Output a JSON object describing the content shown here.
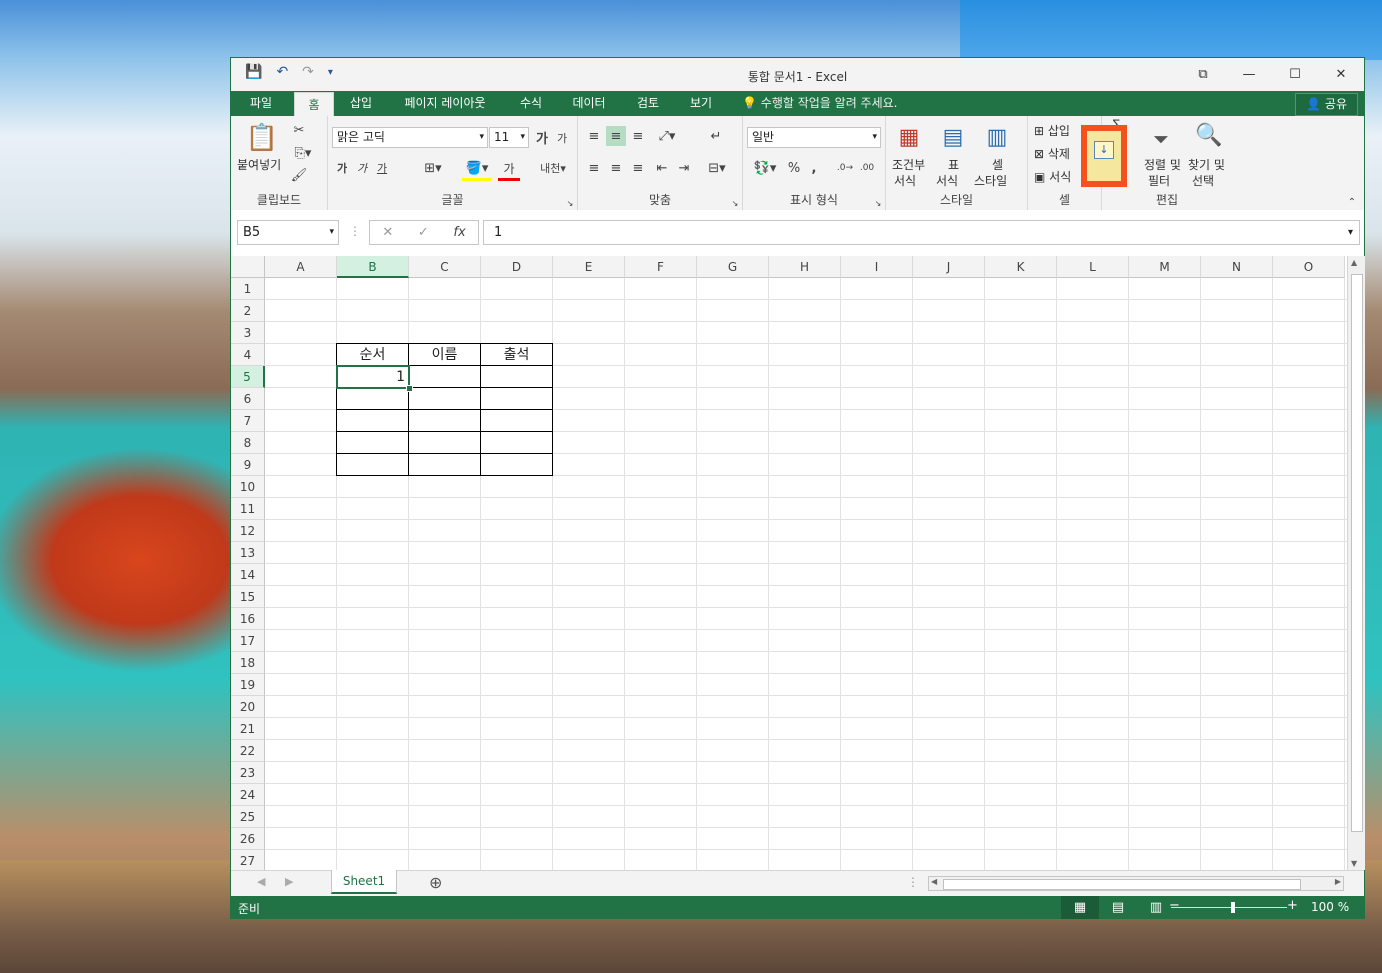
{
  "window": {
    "title": "통합 문서1 - Excel",
    "controls": [
      "⧉",
      "—",
      "☐",
      "✕"
    ]
  },
  "qat": {
    "save_icon": "💾",
    "undo_icon": "↶",
    "redo_icon": "↷",
    "customize_icon": "▾"
  },
  "tabs": {
    "file": "파일",
    "home": "홈",
    "insert": "삽입",
    "page_layout": "페이지 레이아웃",
    "formulas": "수식",
    "data": "데이터",
    "review": "검토",
    "view": "보기",
    "tell_me": "수행할 작업을 알려 주세요.",
    "share": "공유"
  },
  "ribbon": {
    "clipboard": {
      "paste": "붙여넣기",
      "label": "클립보드"
    },
    "font": {
      "name": "맑은 고딕",
      "size": "11",
      "label": "글꼴",
      "bold": "가",
      "italic": "가",
      "underline": "가",
      "grow": "가",
      "shrink": "가",
      "color_a": "가"
    },
    "alignment": {
      "label": "맞춤"
    },
    "number": {
      "format": "일반",
      "label": "표시 형식",
      "percent": "%",
      "comma": ","
    },
    "styles": {
      "conditional": "조건부",
      "conditional2": "서식",
      "table": "표",
      "table2": "서식",
      "cell": "셀",
      "cell2": "스타일",
      "label": "스타일"
    },
    "cells": {
      "insert": "삽입",
      "delete": "삭제",
      "format": "서식",
      "label": "셀"
    },
    "editing": {
      "sort": "정렬 및",
      "sort2": "필터",
      "find": "찾기 및",
      "find2": "선택",
      "label": "편집",
      "sigma": "Σ"
    }
  },
  "formula_bar": {
    "name_box": "B5",
    "value": "1",
    "fx": "fx"
  },
  "columns": [
    "A",
    "B",
    "C",
    "D",
    "E",
    "F",
    "G",
    "H",
    "I",
    "J",
    "K",
    "L",
    "M",
    "N",
    "O"
  ],
  "rows": [
    "1",
    "2",
    "3",
    "4",
    "5",
    "6",
    "7",
    "8",
    "9",
    "10",
    "11",
    "12",
    "13",
    "14",
    "15",
    "16",
    "17",
    "18",
    "19",
    "20",
    "21",
    "22",
    "23",
    "24",
    "25",
    "26",
    "27"
  ],
  "cells": {
    "B4": "순서",
    "C4": "이름",
    "D4": "출석",
    "B5": "1"
  },
  "sheet": {
    "tab": "Sheet1",
    "add": "⊕"
  },
  "status": {
    "ready": "준비",
    "zoom": "100 %"
  },
  "colors": {
    "accent": "#217346",
    "highlight_outline": "#f4511e",
    "highlight_fill": "#f5e79e"
  }
}
